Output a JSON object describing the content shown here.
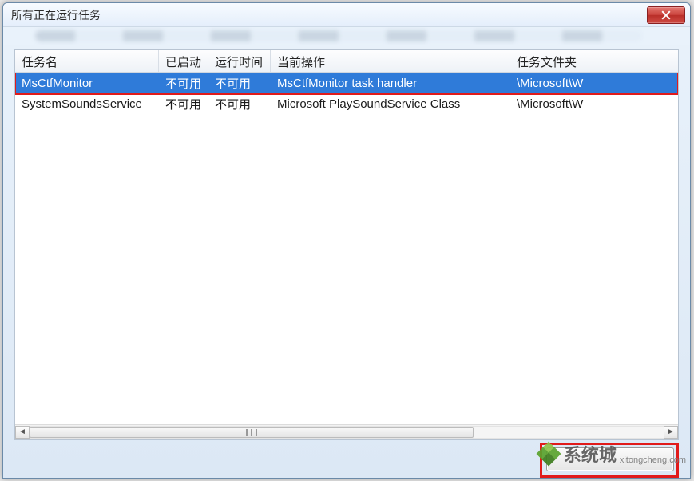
{
  "window": {
    "title": "所有正在运行任务"
  },
  "columns": {
    "name": "任务名",
    "launched": "已启动",
    "runtime": "运行时间",
    "operation": "当前操作",
    "folder": "任务文件夹"
  },
  "rows": [
    {
      "name": "MsCtfMonitor",
      "launched": "不可用",
      "runtime": "不可用",
      "operation": "MsCtfMonitor task handler",
      "folder": "\\Microsoft\\W",
      "selected": true
    },
    {
      "name": "SystemSoundsService",
      "launched": "不可用",
      "runtime": "不可用",
      "operation": "Microsoft PlaySoundService Class",
      "folder": "\\Microsoft\\W",
      "selected": false
    }
  ],
  "watermark": {
    "brand": "系统城",
    "url": "xitongcheng.com"
  }
}
